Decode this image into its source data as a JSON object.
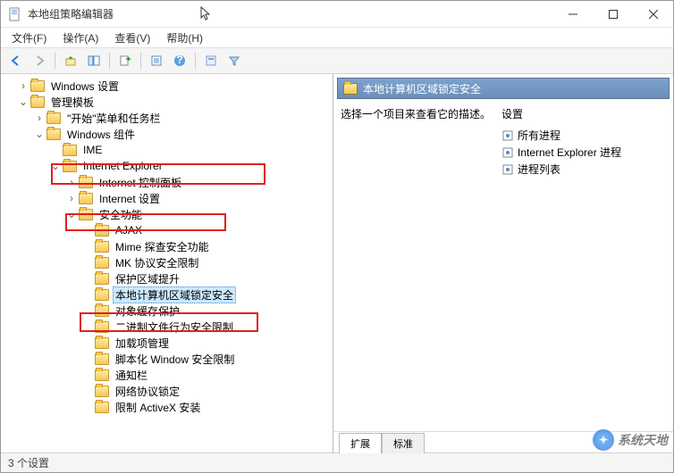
{
  "window": {
    "title": "本地组策略编辑器"
  },
  "menu": {
    "file": "文件(F)",
    "action": "操作(A)",
    "view": "查看(V)",
    "help": "帮助(H)"
  },
  "tree": {
    "windows_settings": "Windows 设置",
    "admin_templates": "管理模板",
    "start_taskbar": "\"开始\"菜单和任务栏",
    "windows_components": "Windows 组件",
    "ime": "IME",
    "internet_explorer": "Internet Explorer",
    "internet_control_panel": "Internet 控制面板",
    "internet_settings": "Internet 设置",
    "security_features": "安全功能",
    "ajax": "AJAX",
    "mime_sniff": "Mime 探查安全功能",
    "mk_protocol": "MK 协议安全限制",
    "zone_elevation": "保护区域提升",
    "local_lockdown": "本地计算机区域锁定安全",
    "object_cache": "对象缓存保护",
    "binary_behavior": "二进制文件行为安全限制",
    "addon_mgmt": "加载项管理",
    "scripted_window": "脚本化 Window 安全限制",
    "notification_bar": "通知栏",
    "network_protocol": "网络协议锁定",
    "activex_install": "限制 ActiveX 安装"
  },
  "right": {
    "header": "本地计算机区域锁定安全",
    "desc": "选择一个项目来查看它的描述。",
    "settings_title": "设置",
    "items": {
      "all_processes": "所有进程",
      "ie_process": "Internet Explorer 进程",
      "process_list": "进程列表"
    }
  },
  "tabs": {
    "extended": "扩展",
    "standard": "标准"
  },
  "status": "3 个设置",
  "watermark": "系统天地"
}
